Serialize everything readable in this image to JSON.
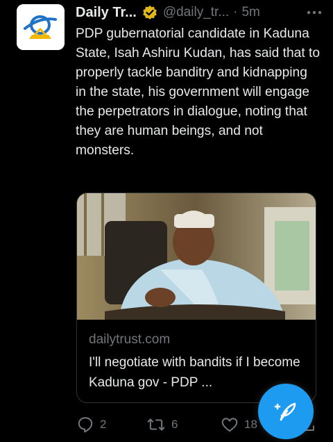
{
  "tweet": {
    "display_name": "Daily Tr...",
    "handle": "@daily_tr...",
    "separator": "·",
    "time": "5m",
    "text": "PDP gubernatorial candidate in Kaduna State, Isah Ashiru Kudan, has said that to properly tackle banditry and kidnapping in the state, his government will engage the perpetrators in dialogue, noting that they are human beings, and not monsters."
  },
  "card": {
    "domain": "dailytrust.com",
    "title": "I'll negotiate with bandits if I become Kaduna gov - PDP ..."
  },
  "actions": {
    "replies": "2",
    "retweets": "6",
    "likes": "18"
  },
  "icons": {
    "avatar": "daily-trust-logo",
    "verified": "verified-badge-icon",
    "more": "more-icon",
    "reply": "reply-icon",
    "retweet": "retweet-icon",
    "like": "heart-icon",
    "share": "share-icon",
    "compose": "compose-icon"
  },
  "colors": {
    "background": "#000000",
    "text": "#e7e9ea",
    "muted": "#71767b",
    "accent": "#1d9bf0",
    "verified": "#e2b719"
  }
}
